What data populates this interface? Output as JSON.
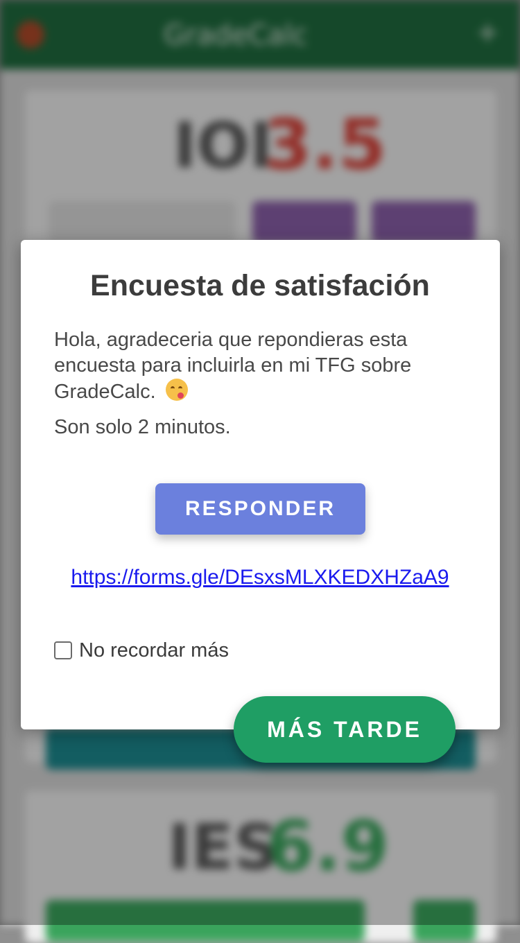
{
  "background_app": {
    "title": "GradeCalc",
    "card1": {
      "label": "IOI",
      "grade": "3.5",
      "grade_color": "#d9433a"
    },
    "card2": {
      "label": "IES",
      "grade": "6.9",
      "grade_color": "#3aa45c"
    },
    "appbar_color": "#1f6b3e"
  },
  "dialog": {
    "title": "Encuesta de satisfación",
    "message": "Hola, agradeceria que repondieras esta encuesta para incluirla en mi TFG sobre GradeCalc.",
    "emoji": "yum-face-emoji",
    "note": "Son solo 2 minutos.",
    "respond_label": "RESPONDER",
    "link": "https://forms.gle/DEsxsMLXKEDXHZaA9",
    "dont_remind_label": "No recordar más",
    "dont_remind_checked": false,
    "later_label": "MÁS TARDE"
  },
  "colors": {
    "respond_button": "#6b80dd",
    "later_button": "#1f9e64",
    "link": "#1a1aee"
  }
}
